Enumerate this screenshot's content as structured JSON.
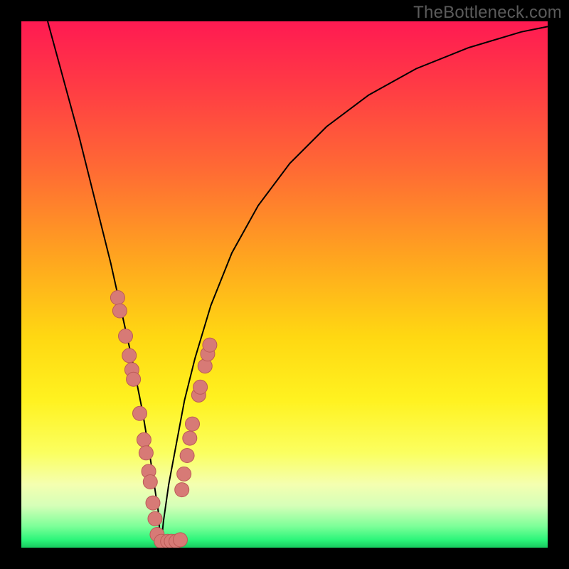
{
  "watermark": "TheBottleneck.com",
  "colors": {
    "frame": "#000000",
    "curve": "#000000",
    "marker_fill": "#d77a76",
    "marker_stroke": "#bb5b57",
    "gradient_stops": [
      {
        "offset": 0.0,
        "color": "#ff1a52"
      },
      {
        "offset": 0.12,
        "color": "#ff3a45"
      },
      {
        "offset": 0.28,
        "color": "#ff6a34"
      },
      {
        "offset": 0.45,
        "color": "#ffa51f"
      },
      {
        "offset": 0.6,
        "color": "#ffd812"
      },
      {
        "offset": 0.72,
        "color": "#fff220"
      },
      {
        "offset": 0.82,
        "color": "#fbff60"
      },
      {
        "offset": 0.88,
        "color": "#f4ffb0"
      },
      {
        "offset": 0.92,
        "color": "#d6ffb8"
      },
      {
        "offset": 0.96,
        "color": "#7bff98"
      },
      {
        "offset": 0.985,
        "color": "#2cf57a"
      },
      {
        "offset": 1.0,
        "color": "#17c95e"
      }
    ]
  },
  "chart_data": {
    "type": "line",
    "title": "",
    "xlabel": "",
    "ylabel": "",
    "xlim": [
      0,
      100
    ],
    "ylim": [
      0,
      100
    ],
    "curve_vertex_x": 26.5,
    "series": [
      {
        "name": "bottleneck-curve",
        "x": [
          5,
          8,
          11,
          14,
          17,
          19,
          21,
          23,
          24.5,
          26,
          26.5,
          27,
          28,
          29.5,
          31,
          33,
          36,
          40,
          45,
          51,
          58,
          66,
          75,
          85,
          95,
          100
        ],
        "y": [
          100,
          89,
          78,
          66,
          54,
          45,
          36,
          26,
          17,
          7,
          0,
          5,
          12,
          20,
          28,
          36,
          46,
          56,
          65,
          73,
          80,
          86,
          91,
          95,
          98,
          99
        ]
      }
    ],
    "markers": [
      {
        "x": 18.3,
        "y": 47.5
      },
      {
        "x": 18.7,
        "y": 45.0
      },
      {
        "x": 19.8,
        "y": 40.2
      },
      {
        "x": 20.5,
        "y": 36.5
      },
      {
        "x": 21.0,
        "y": 33.8
      },
      {
        "x": 21.3,
        "y": 32.0
      },
      {
        "x": 22.5,
        "y": 25.5
      },
      {
        "x": 23.3,
        "y": 20.5
      },
      {
        "x": 23.7,
        "y": 18.0
      },
      {
        "x": 24.2,
        "y": 14.5
      },
      {
        "x": 24.5,
        "y": 12.5
      },
      {
        "x": 25.0,
        "y": 8.5
      },
      {
        "x": 25.4,
        "y": 5.5
      },
      {
        "x": 25.8,
        "y": 2.5
      },
      {
        "x": 26.6,
        "y": 1.2
      },
      {
        "x": 27.8,
        "y": 1.2
      },
      {
        "x": 28.5,
        "y": 1.2
      },
      {
        "x": 29.4,
        "y": 1.2
      },
      {
        "x": 30.2,
        "y": 1.5
      },
      {
        "x": 30.5,
        "y": 11.0
      },
      {
        "x": 30.9,
        "y": 14.0
      },
      {
        "x": 31.5,
        "y": 17.5
      },
      {
        "x": 32.0,
        "y": 20.8
      },
      {
        "x": 32.5,
        "y": 23.5
      },
      {
        "x": 33.7,
        "y": 29.0
      },
      {
        "x": 34.0,
        "y": 30.5
      },
      {
        "x": 34.9,
        "y": 34.5
      },
      {
        "x": 35.4,
        "y": 36.8
      },
      {
        "x": 35.8,
        "y": 38.5
      }
    ]
  }
}
